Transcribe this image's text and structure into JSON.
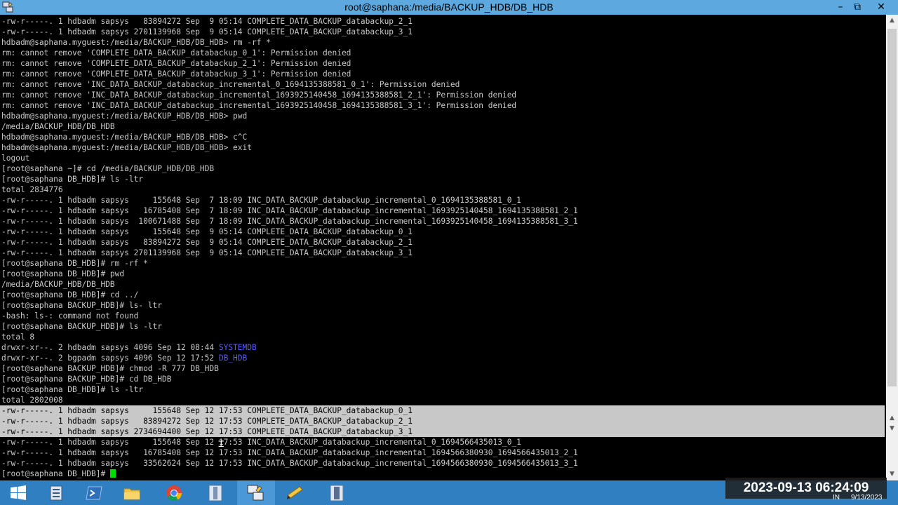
{
  "window": {
    "title": "root@saphana:/media/BACKUP_HDB/DB_HDB"
  },
  "terminal_lines": [
    "-rw-r-----. 1 hdbadm sapsys   83894272 Sep  9 05:14 COMPLETE_DATA_BACKUP_databackup_2_1",
    "-rw-r-----. 1 hdbadm sapsys 2701139968 Sep  9 05:14 COMPLETE_DATA_BACKUP_databackup_3_1",
    "hdbadm@saphana.myguest:/media/BACKUP_HDB/DB_HDB> rm -rf *",
    "rm: cannot remove 'COMPLETE_DATA_BACKUP_databackup_0_1': Permission denied",
    "rm: cannot remove 'COMPLETE_DATA_BACKUP_databackup_2_1': Permission denied",
    "rm: cannot remove 'COMPLETE_DATA_BACKUP_databackup_3_1': Permission denied",
    "rm: cannot remove 'INC_DATA_BACKUP_databackup_incremental_0_1694135388581_0_1': Permission denied",
    "rm: cannot remove 'INC_DATA_BACKUP_databackup_incremental_1693925140458_1694135388581_2_1': Permission denied",
    "rm: cannot remove 'INC_DATA_BACKUP_databackup_incremental_1693925140458_1694135388581_3_1': Permission denied",
    "hdbadm@saphana.myguest:/media/BACKUP_HDB/DB_HDB> pwd",
    "/media/BACKUP_HDB/DB_HDB",
    "hdbadm@saphana.myguest:/media/BACKUP_HDB/DB_HDB> c^C",
    "hdbadm@saphana.myguest:/media/BACKUP_HDB/DB_HDB> exit",
    "logout",
    "[root@saphana ~]# cd /media/BACKUP_HDB/DB_HDB",
    "[root@saphana DB_HDB]# ls -ltr",
    "total 2834776",
    "-rw-r-----. 1 hdbadm sapsys     155648 Sep  7 18:09 INC_DATA_BACKUP_databackup_incremental_0_1694135388581_0_1",
    "-rw-r-----. 1 hdbadm sapsys   16785408 Sep  7 18:09 INC_DATA_BACKUP_databackup_incremental_1693925140458_1694135388581_2_1",
    "-rw-r-----. 1 hdbadm sapsys  100671488 Sep  7 18:09 INC_DATA_BACKUP_databackup_incremental_1693925140458_1694135388581_3_1",
    "-rw-r-----. 1 hdbadm sapsys     155648 Sep  9 05:14 COMPLETE_DATA_BACKUP_databackup_0_1",
    "-rw-r-----. 1 hdbadm sapsys   83894272 Sep  9 05:14 COMPLETE_DATA_BACKUP_databackup_2_1",
    "-rw-r-----. 1 hdbadm sapsys 2701139968 Sep  9 05:14 COMPLETE_DATA_BACKUP_databackup_3_1",
    "[root@saphana DB_HDB]# rm -rf *",
    "[root@saphana DB_HDB]# pwd",
    "/media/BACKUP_HDB/DB_HDB",
    "[root@saphana DB_HDB]# cd ../",
    "[root@saphana BACKUP_HDB]# ls- ltr",
    "-bash: ls-: command not found",
    "[root@saphana BACKUP_HDB]# ls -ltr",
    "total 8",
    "drwxr-xr--. 2 hdbadm sapsys 4096 Sep 12 08:44 ",
    "drwxr-xr--. 2 bgpadm sapsys 4096 Sep 12 17:52 ",
    "[root@saphana BACKUP_HDB]# chmod -R 777 DB_HDB",
    "[root@saphana BACKUP_HDB]# cd DB_HDB",
    "[root@saphana DB_HDB]# ls -ltr",
    "total 2802008",
    "-rw-r-----. 1 hdbadm sapsys     155648 Sep 12 17:53 COMPLETE_DATA_BACKUP_databackup_0_1",
    "-rw-r-----. 1 hdbadm sapsys   83894272 Sep 12 17:53 COMPLETE_DATA_BACKUP_databackup_2_1",
    "-rw-r-----. 1 hdbadm sapsys 2734694400 Sep 12 17:53 COMPLETE_DATA_BACKUP_databackup_3_1",
    "-rw-r-----. 1 hdbadm sapsys     155648 Sep 12 17:53 INC_DATA_BACKUP_databackup_incremental_0_1694566435013_0_1",
    "-rw-r-----. 1 hdbadm sapsys   16785408 Sep 12 17:53 INC_DATA_BACKUP_databackup_incremental_1694566380930_1694566435013_2_1",
    "-rw-r-----. 1 hdbadm sapsys   33562624 Sep 12 17:53 INC_DATA_BACKUP_databackup_incremental_1694566380930_1694566435013_3_1",
    "[root@saphana DB_HDB]# "
  ],
  "dir_names": {
    "line_31": "SYSTEMDB",
    "line_32": "DB_HDB"
  },
  "selected_lines": [
    37,
    38,
    39
  ],
  "taskbar": {
    "items": [
      "start-icon",
      "server-manager-icon",
      "powershell-icon",
      "file-explorer-icon",
      "chrome-icon",
      "archive-icon",
      "putty-icon",
      "notepad-icon",
      "document-icon"
    ],
    "active_index": 6
  },
  "clock": {
    "overlay": "2023-09-13 06:24:09",
    "date": "9/13/2023",
    "lang": "IN"
  },
  "colors": {
    "terminal_bg": "#000000",
    "terminal_fg": "#c8c8c8",
    "dir_blue": "#5c5cff",
    "cursor": "#00e000",
    "titlebar": "#5ea8e0",
    "taskbar": "#2f7fc1"
  }
}
